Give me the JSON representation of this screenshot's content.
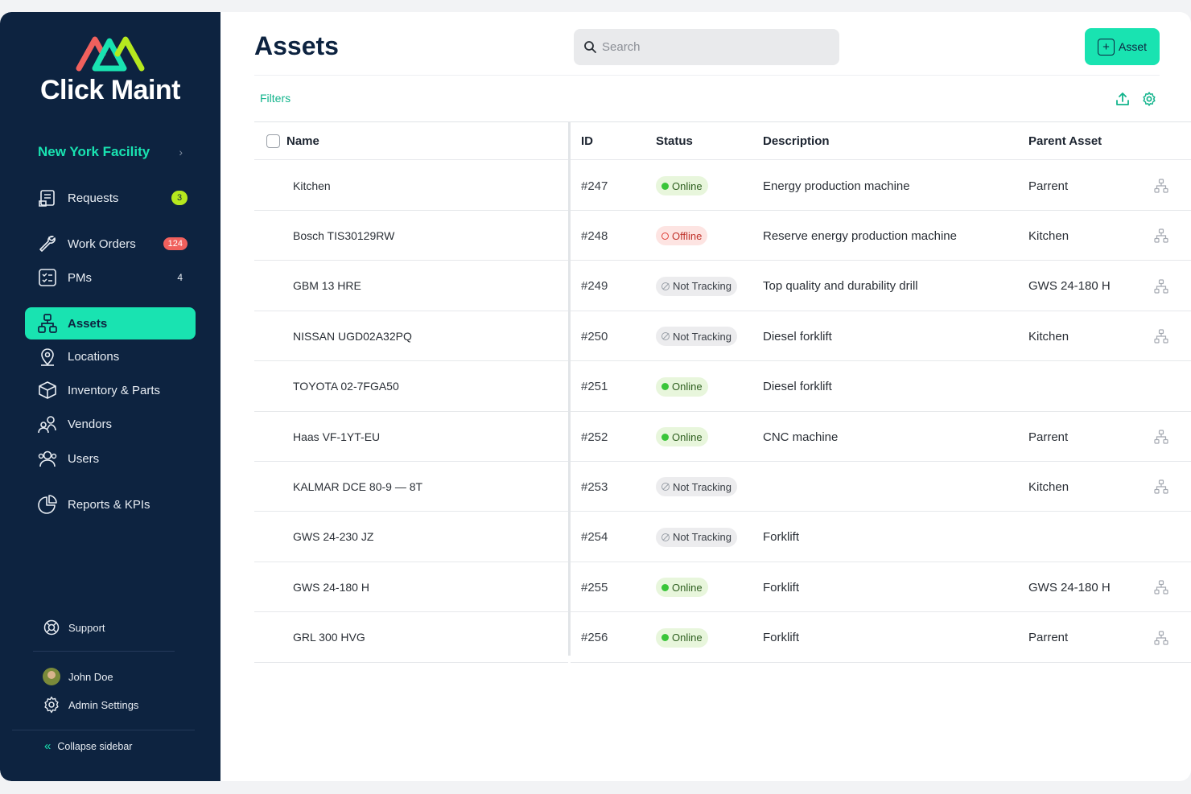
{
  "app": {
    "name": "Click Maint"
  },
  "sidebar": {
    "facility": "New York Facility",
    "items": [
      {
        "label": "Requests",
        "icon": "requests-icon",
        "badge": "3"
      },
      {
        "label": "Work Orders",
        "icon": "wrench-icon",
        "badge": "124"
      },
      {
        "label": "PMs",
        "icon": "checklist-icon",
        "badge": "4"
      },
      {
        "label": "Assets",
        "icon": "hierarchy-icon",
        "active": true
      },
      {
        "label": "Locations",
        "icon": "location-pin-icon"
      },
      {
        "label": "Inventory & Parts",
        "icon": "box-icon"
      },
      {
        "label": "Vendors",
        "icon": "vendors-icon"
      },
      {
        "label": "Users",
        "icon": "users-icon"
      },
      {
        "label": "Reports & KPIs",
        "icon": "pie-chart-icon"
      }
    ],
    "support": "Support",
    "user_name": "John Doe",
    "admin_settings": "Admin Settings",
    "collapse": "Collapse sidebar"
  },
  "header": {
    "title": "Assets",
    "search_placeholder": "Search",
    "add_button": "Asset",
    "filters": "Filters"
  },
  "table": {
    "columns": {
      "name": "Name",
      "id": "ID",
      "status": "Status",
      "description": "Description",
      "parent": "Parent Asset"
    },
    "rows": [
      {
        "name": "Kitchen",
        "id": "#247",
        "status": "Online",
        "status_type": "online",
        "description": "Energy production machine",
        "parent": "Parrent",
        "has_children": true
      },
      {
        "name": "Bosch TIS30129RW",
        "id": "#248",
        "status": "Offline",
        "status_type": "offline",
        "description": "Reserve energy production machine",
        "parent": "Kitchen",
        "has_children": true
      },
      {
        "name": "GBM 13 HRE",
        "id": "#249",
        "status": "Not Tracking",
        "status_type": "nottracking",
        "description": "Top quality and durability drill",
        "parent": "GWS 24-180 H",
        "has_children": true
      },
      {
        "name": "NISSAN UGD02A32PQ",
        "id": "#250",
        "status": "Not Tracking",
        "status_type": "nottracking",
        "description": "Diesel forklift",
        "parent": "Kitchen",
        "has_children": true
      },
      {
        "name": "TOYOTA 02-7FGA50",
        "id": "#251",
        "status": "Online",
        "status_type": "online",
        "description": "Diesel forklift",
        "parent": "",
        "has_children": false
      },
      {
        "name": "Haas VF-1YT-EU",
        "id": "#252",
        "status": "Online",
        "status_type": "online",
        "description": "CNC machine",
        "parent": "Parrent",
        "has_children": true
      },
      {
        "name": "KALMAR DCE 80-9 — 8T",
        "id": "#253",
        "status": "Not Tracking",
        "status_type": "nottracking",
        "description": "",
        "parent": "Kitchen",
        "has_children": true
      },
      {
        "name": "GWS 24-230 JZ",
        "id": "#254",
        "status": "Not Tracking",
        "status_type": "nottracking",
        "description": "Forklift",
        "parent": "",
        "has_children": false
      },
      {
        "name": "GWS 24-180 H",
        "id": "#255",
        "status": "Online",
        "status_type": "online",
        "description": "Forklift",
        "parent": "GWS 24-180 H",
        "has_children": true
      },
      {
        "name": "GRL 300 HVG",
        "id": "#256",
        "status": "Online",
        "status_type": "online",
        "description": "Forklift",
        "parent": "Parrent",
        "has_children": true
      }
    ]
  },
  "colors": {
    "sidebar_bg": "#0d2340",
    "accent": "#19e3b1",
    "online": "#3ac53a",
    "offline": "#e0423a"
  }
}
